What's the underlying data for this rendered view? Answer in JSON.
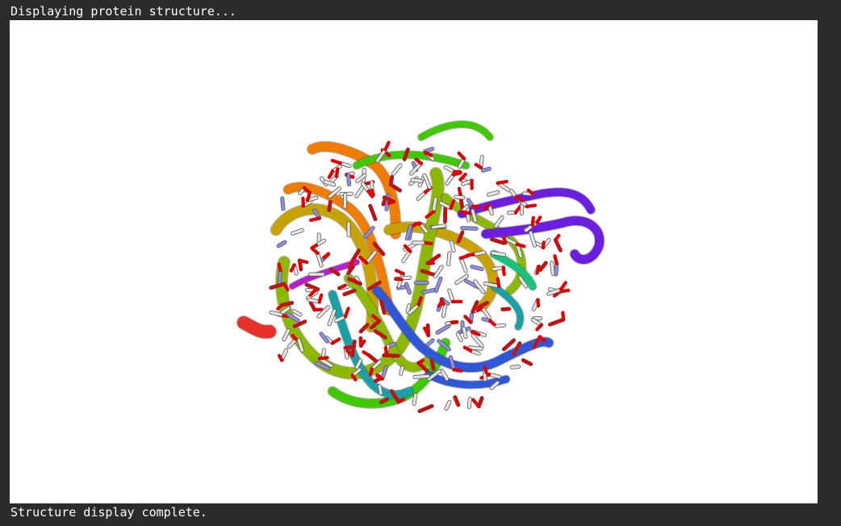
{
  "output": {
    "status_start": "Displaying protein structure...",
    "status_end": "Structure display complete."
  },
  "viewer": {
    "background": "#ffffff",
    "chain_colors": [
      "#e8312b",
      "#f07c00",
      "#c8a200",
      "#8db800",
      "#3fc900",
      "#18c27a",
      "#1aa0a8",
      "#2f57d8",
      "#6b1ee0",
      "#b520c8"
    ],
    "atom_colors": {
      "carbon": "#e6e6e6",
      "nitrogen": "#8f8fe8",
      "oxygen": "#e00000"
    }
  }
}
